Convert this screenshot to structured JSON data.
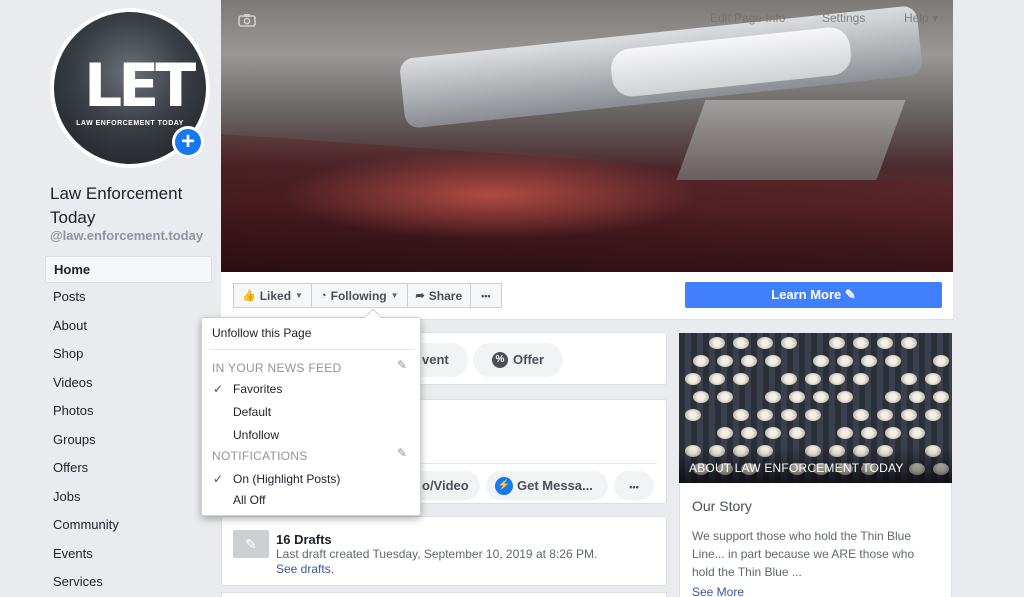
{
  "page": {
    "name": "Law Enforcement Today",
    "handle": "@law.enforcement.today",
    "logo_letters": "LET",
    "logo_sub": "LAW ENFORCEMENT TODAY"
  },
  "sidebar": {
    "items": [
      {
        "label": "Home",
        "active": true
      },
      {
        "label": "Posts"
      },
      {
        "label": "About"
      },
      {
        "label": "Shop"
      },
      {
        "label": "Videos"
      },
      {
        "label": "Photos"
      },
      {
        "label": "Groups"
      },
      {
        "label": "Offers"
      },
      {
        "label": "Jobs"
      },
      {
        "label": "Community"
      },
      {
        "label": "Events"
      },
      {
        "label": "Services"
      }
    ]
  },
  "cover": {
    "menu": [
      "Edit Page Info",
      "Settings",
      "Help ▾"
    ]
  },
  "actions": {
    "liked": "Liked",
    "following": "Following",
    "share": "Share",
    "more": "•••",
    "learn_more": "Learn More ✎"
  },
  "composer": {
    "event_partial": "vent",
    "offer": "Offer",
    "photo_video_partial": "o/Video",
    "get_messages": "Get Messa...",
    "more": "•••"
  },
  "drafts": {
    "title": "16 Drafts",
    "subtitle": "Last draft created Tuesday, September 10, 2019 at 8:26 PM.",
    "link": "See drafts."
  },
  "about": {
    "title": "ABOUT LAW ENFORCEMENT TODAY",
    "story_heading": "Our Story",
    "story_body": "We support those who hold the Thin Blue Line... in part because we ARE those who hold the Thin Blue ...",
    "see_more": "See More"
  },
  "dropdown": {
    "unfollow_page": "Unfollow this Page",
    "news_feed_heading": "IN YOUR NEWS FEED",
    "favorites": "Favorites",
    "default": "Default",
    "unfollow": "Unfollow",
    "notifications_heading": "NOTIFICATIONS",
    "on_highlight": "On (Highlight Posts)",
    "all_off": "All Off"
  },
  "colors": {
    "accent": "#4080ff",
    "link": "#385898",
    "background": "#e9ebee"
  }
}
